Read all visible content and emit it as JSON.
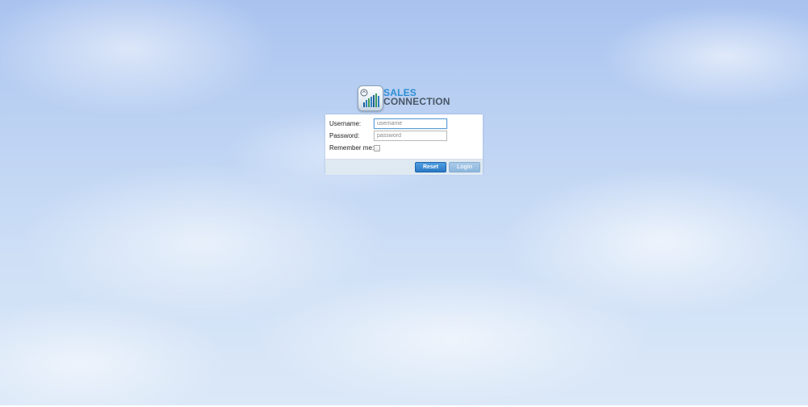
{
  "logo": {
    "line1": "SALES",
    "line2": "CONNECTION"
  },
  "form": {
    "username_label": "Username:",
    "username_placeholder": "username",
    "username_value": "",
    "password_label": "Password:",
    "password_placeholder": "password",
    "password_value": "",
    "remember_label": "Remember me:",
    "remember_checked": false
  },
  "buttons": {
    "reset_label": "Reset",
    "login_label": "Login"
  },
  "colors": {
    "accent": "#2e8ed3",
    "reset_button": "#2a78c4",
    "login_button_disabled": "#8db7dc",
    "footer_bar": "#dfe9f1"
  },
  "icons": {
    "logo_badge": "bar-chart-icon"
  }
}
